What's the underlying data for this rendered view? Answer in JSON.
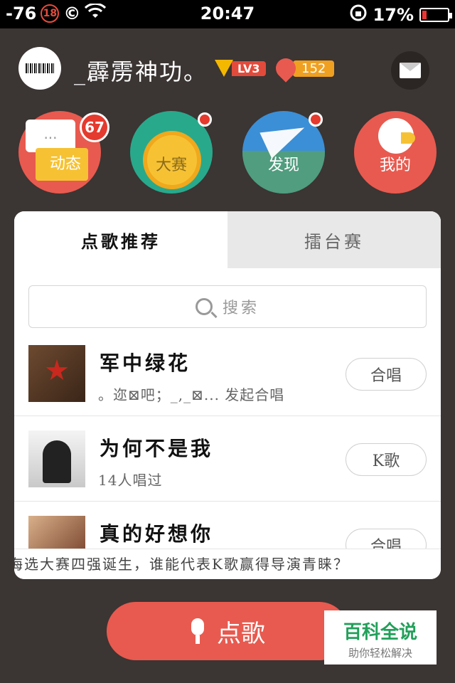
{
  "status_bar": {
    "signal": "-76",
    "badge": "18",
    "copyright": "©",
    "time": "20:47",
    "battery": "17%",
    "battery_level": 0.17
  },
  "profile": {
    "username": "_霹雳神功。",
    "level": "LV3",
    "flowers": "152"
  },
  "nav": {
    "items": [
      {
        "label": "动态",
        "badge": "67",
        "bubble": "..."
      },
      {
        "label": "大赛"
      },
      {
        "label": "发现"
      },
      {
        "label": "我的"
      }
    ]
  },
  "tabs": [
    {
      "label": "点歌推荐",
      "active": true
    },
    {
      "label": "擂台赛",
      "active": false
    }
  ],
  "search": {
    "placeholder": "搜索"
  },
  "songs": [
    {
      "title": "军中绿花",
      "subtitle": "。迩⊠吧；_,_⊠... 发起合唱",
      "action": "合唱"
    },
    {
      "title": "为何不是我",
      "subtitle": "14人唱过",
      "action": "K歌"
    },
    {
      "title": "真的好想你",
      "subtitle": "",
      "action": "合唱"
    }
  ],
  "ticker": {
    "text": "海选大赛四强诞生，谁能代表K歌赢得导演青睐？"
  },
  "bottom": {
    "sing_label": "点歌"
  },
  "watermark": {
    "title": "百科全说",
    "subtitle": "助你轻松解决"
  },
  "colors": {
    "background": "#3b3533",
    "accent": "#e85a4f",
    "badge_red": "#e53a2e"
  }
}
